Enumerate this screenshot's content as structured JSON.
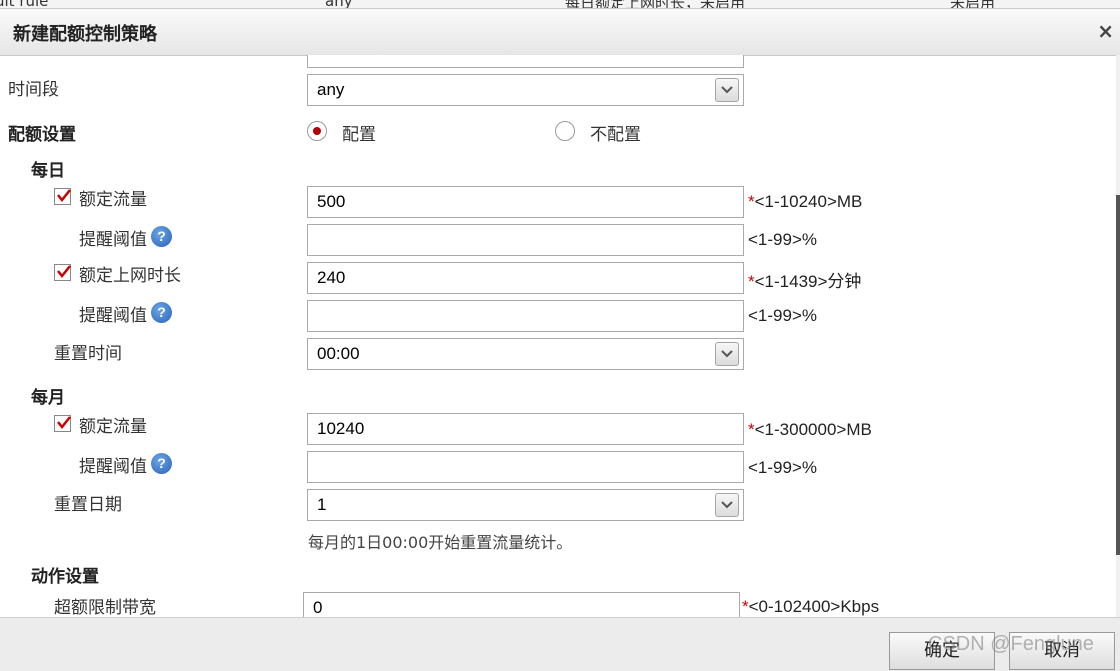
{
  "background_row": {
    "col1": "ult rule",
    "col2": "any",
    "col3": "每日额定上网时长，未启用",
    "col4": "未启用"
  },
  "dialog": {
    "title": "新建配额控制策略",
    "close_label": "×"
  },
  "time_period": {
    "label": "时间段",
    "value": "any"
  },
  "quota_settings": {
    "label": "配额设置",
    "option_configure": "配置",
    "option_not_configure": "不配置",
    "selected": "配置"
  },
  "daily": {
    "heading": "每日",
    "traffic": {
      "label": "额定流量",
      "checked": true,
      "value": "500",
      "hint_req": "*",
      "hint": "<1-10240>MB"
    },
    "traffic_threshold": {
      "label": "提醒阈值",
      "value": "",
      "hint": "<1-99>%"
    },
    "online_time": {
      "label": "额定上网时长",
      "checked": true,
      "value": "240",
      "hint_req": "*",
      "hint": "<1-1439>分钟"
    },
    "time_threshold": {
      "label": "提醒阈值",
      "value": "",
      "hint": "<1-99>%"
    },
    "reset_time": {
      "label": "重置时间",
      "value": "00:00"
    }
  },
  "monthly": {
    "heading": "每月",
    "traffic": {
      "label": "额定流量",
      "checked": true,
      "value": "10240",
      "hint_req": "*",
      "hint": "<1-300000>MB"
    },
    "traffic_threshold": {
      "label": "提醒阈值",
      "value": "",
      "hint": "<1-99>%"
    },
    "reset_date": {
      "label": "重置日期",
      "value": "1"
    },
    "note": "每月的1日00:00开始重置流量统计。"
  },
  "action_settings": {
    "heading": "动作设置",
    "over_limit_bandwidth": {
      "label": "超额限制带宽",
      "value": "0",
      "hint_req": "*",
      "hint": "<0-102400>Kbps"
    }
  },
  "footer": {
    "confirm_label": "确定",
    "cancel_label": "取消"
  },
  "help_glyph": "?",
  "watermark": "CSDN @Fenglune",
  "colors": {
    "required": "#cc0000",
    "radio_selected": "#b00000",
    "help_icon": "#2a62b8"
  }
}
